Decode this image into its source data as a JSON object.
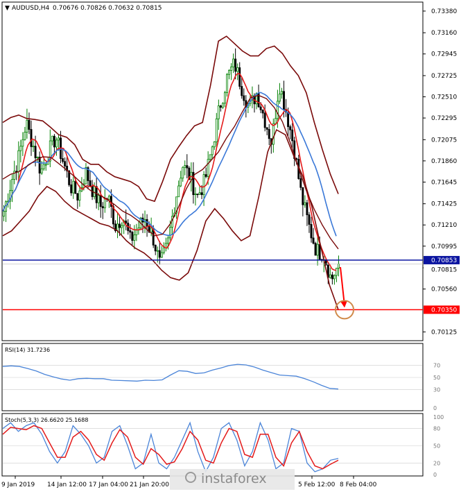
{
  "header": {
    "symbol": "AUDUSD,H4",
    "quote": "0.70676 0.70826 0.70632 0.70815"
  },
  "indicators": {
    "rsi_label": "RSI(14) 31.7236",
    "stoch_label": "Stoch(5,3,3) 26.6620 25.1688"
  },
  "levels": {
    "blue_line": "0.70853",
    "red_line": "0.70350",
    "current_price": "0.70815"
  },
  "watermark": "instaforex",
  "colors": {
    "bull_candle": "#008000",
    "bear_candle": "#000000",
    "ma_fast": "#e41a1a",
    "ma_slow": "#3a78d8",
    "bollinger": "#7a0a0a",
    "blue_level": "#0a14a0",
    "red_level": "#ff0000",
    "rsi_line": "#4a84d8",
    "stoch_main": "#4a84d8",
    "stoch_signal": "#e41a1a",
    "target_circle": "#d08a4a"
  },
  "chart_data": [
    {
      "type": "candlestick",
      "panel": "price",
      "y_ticks": [
        "0.73380",
        "0.73160",
        "0.72945",
        "0.72725",
        "0.72510",
        "0.72295",
        "0.72075",
        "0.71860",
        "0.71645",
        "0.71425",
        "0.71210",
        "0.70995",
        "0.70775",
        "0.70560",
        "0.70125"
      ],
      "ylim": [
        0.7005,
        0.7345
      ],
      "x_ticks": [
        "9 Jan 2019",
        "14 Jan 12:00",
        "17 Jan 04:00",
        "21 Jan 20:00",
        "5 Feb 12:00",
        "8 Feb 04:00"
      ],
      "price_path": [
        0.7135,
        0.7165,
        0.719,
        0.7225,
        0.72,
        0.7175,
        0.7195,
        0.721,
        0.7185,
        0.716,
        0.715,
        0.7175,
        0.7155,
        0.714,
        0.715,
        0.712,
        0.713,
        0.7105,
        0.7118,
        0.7128,
        0.711,
        0.708,
        0.71,
        0.7145,
        0.7182,
        0.717,
        0.715,
        0.7165,
        0.72,
        0.724,
        0.727,
        0.7285,
        0.726,
        0.724,
        0.7255,
        0.723,
        0.7205,
        0.7265,
        0.7235,
        0.72,
        0.715,
        0.712,
        0.7095,
        0.7092,
        0.7065,
        0.7081
      ],
      "bollinger_upper": [
        0.7225,
        0.7235,
        0.723,
        0.7228,
        0.7228,
        0.7225,
        0.7215,
        0.721,
        0.721,
        0.7195,
        0.718,
        0.7185,
        0.718,
        0.717,
        0.717,
        0.7165,
        0.7165,
        0.7155,
        0.714,
        0.715,
        0.718,
        0.7195,
        0.7205,
        0.7218,
        0.7225,
        0.7225,
        0.73,
        0.7315,
        0.731,
        0.73,
        0.7295,
        0.729,
        0.7295,
        0.7305,
        0.73,
        0.729,
        0.7275,
        0.727,
        0.724,
        0.721,
        0.7185,
        0.716,
        0.7145
      ],
      "bollinger_lower": [
        0.711,
        0.712,
        0.713,
        0.714,
        0.716,
        0.716,
        0.715,
        0.714,
        0.7135,
        0.713,
        0.7125,
        0.712,
        0.712,
        0.711,
        0.71,
        0.7095,
        0.709,
        0.708,
        0.707,
        0.7065,
        0.7065,
        0.708,
        0.711,
        0.714,
        0.7135,
        0.712,
        0.711,
        0.71,
        0.712,
        0.718,
        0.721,
        0.7225,
        0.72,
        0.718,
        0.716,
        0.712,
        0.708,
        0.704,
        0.703
      ]
    },
    {
      "type": "line",
      "panel": "rsi",
      "y_ticks": [
        "70",
        "50",
        "30",
        "0"
      ],
      "ylim": [
        0,
        100
      ],
      "values": [
        68,
        70,
        66,
        63,
        58,
        52,
        50,
        45,
        46,
        50,
        47,
        49,
        47,
        44,
        46,
        43,
        45,
        46,
        44,
        48,
        60,
        62,
        58,
        55,
        60,
        64,
        67,
        72,
        71,
        70,
        64,
        60,
        56,
        52,
        54,
        50,
        46,
        40,
        34,
        30,
        32
      ]
    },
    {
      "type": "line",
      "panel": "stochastic",
      "y_ticks": [
        "100",
        "80",
        "50",
        "20",
        "0"
      ],
      "ylim": [
        0,
        100
      ],
      "main": [
        80,
        90,
        75,
        85,
        90,
        70,
        40,
        20,
        40,
        85,
        70,
        50,
        20,
        30,
        75,
        85,
        50,
        10,
        20,
        70,
        20,
        10,
        30,
        60,
        90,
        40,
        5,
        30,
        80,
        90,
        60,
        15,
        40,
        90,
        60,
        10,
        20,
        80,
        75,
        20,
        5,
        10,
        25,
        28
      ],
      "signal": [
        70,
        82,
        80,
        78,
        85,
        80,
        55,
        30,
        30,
        65,
        75,
        60,
        35,
        25,
        55,
        78,
        65,
        30,
        18,
        45,
        35,
        18,
        22,
        45,
        75,
        60,
        25,
        20,
        55,
        80,
        75,
        35,
        30,
        70,
        70,
        30,
        15,
        55,
        75,
        40,
        15,
        10,
        18,
        25
      ]
    }
  ]
}
